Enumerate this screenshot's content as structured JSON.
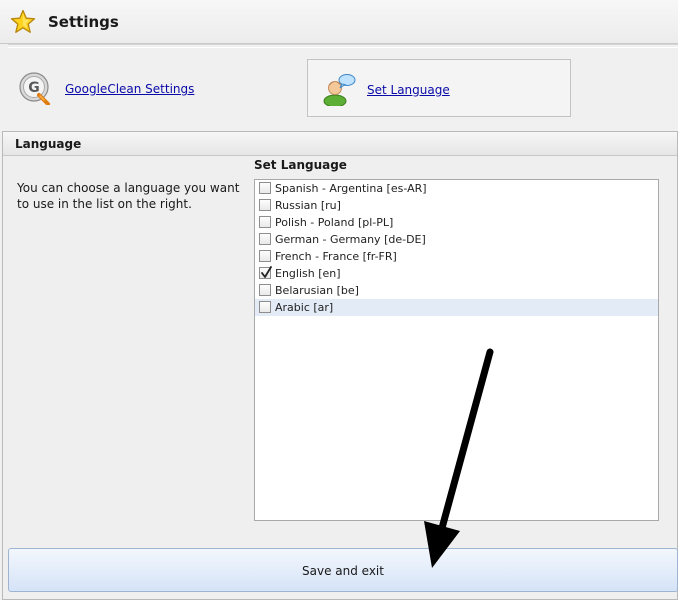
{
  "window": {
    "title": "Settings",
    "icon": "star-icon"
  },
  "nav": {
    "items": [
      {
        "label": "GoogleClean Settings",
        "icon": "googleclean-settings-icon",
        "active": false
      },
      {
        "label": "Set Language",
        "icon": "user-speech-icon",
        "active": true
      }
    ]
  },
  "panel": {
    "header": "Language",
    "description": "You can choose a language you want to use in the list on the right.",
    "list_title": "Set Language",
    "languages": [
      {
        "label": "Spanish - Argentina [es-AR]",
        "checked": false
      },
      {
        "label": "Russian [ru]",
        "checked": false
      },
      {
        "label": "Polish - Poland [pl-PL]",
        "checked": false
      },
      {
        "label": "German - Germany [de-DE]",
        "checked": false
      },
      {
        "label": "French - France [fr-FR]",
        "checked": false
      },
      {
        "label": "English [en]",
        "checked": true
      },
      {
        "label": "Belarusian [be]",
        "checked": false
      },
      {
        "label": "Arabic [ar]",
        "checked": false
      }
    ],
    "highlighted_index": 7
  },
  "save_button": {
    "label": "Save and exit"
  },
  "colors": {
    "link": "#0a0aa8",
    "button_gradient_top": "#f3f7fd",
    "button_gradient_bottom": "#d5e3f7",
    "row_highlight": "#e3ebf6"
  }
}
